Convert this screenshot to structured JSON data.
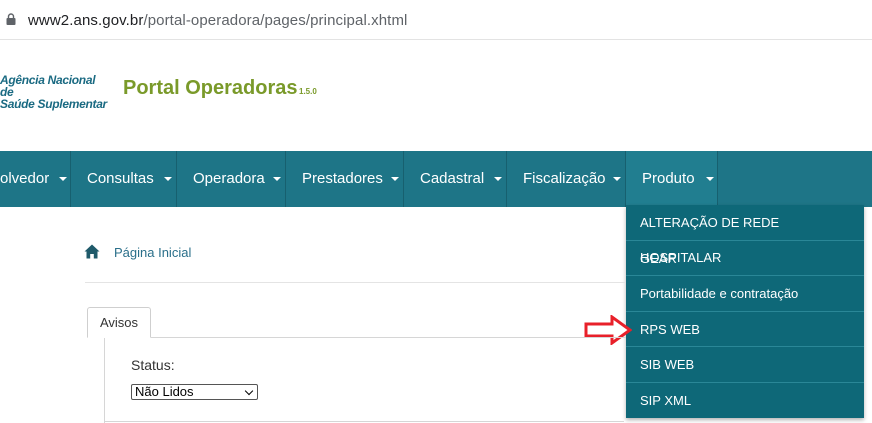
{
  "browser": {
    "url_host": "www2.ans.gov.br",
    "url_path": "/portal-operadora/pages/principal.xhtml"
  },
  "header": {
    "logo_line1": "Agência Nacional de",
    "logo_line2": "Saúde Suplementar",
    "title": "Portal Operadoras",
    "version": "1.5.0"
  },
  "nav": {
    "items": [
      {
        "label": "olvedor"
      },
      {
        "label": "Consultas"
      },
      {
        "label": "Operadora"
      },
      {
        "label": "Prestadores"
      },
      {
        "label": "Cadastral"
      },
      {
        "label": "Fiscalização"
      },
      {
        "label": "Produto"
      }
    ],
    "color": "#1e7587"
  },
  "dropdown": {
    "items": [
      {
        "label": "ALTERAÇÃO DE REDE HOSPITALAR"
      },
      {
        "label": "GEAR"
      },
      {
        "label": "Portabilidade e contratação"
      },
      {
        "label": "RPS WEB"
      },
      {
        "label": "SIB WEB"
      },
      {
        "label": "SIP XML"
      }
    ],
    "color": "#0e6878"
  },
  "annotation": {
    "arrow_color": "#e8202a",
    "icon": "red-arrow-icon"
  },
  "breadcrumb": {
    "icon": "home-icon",
    "label": "Página Inicial"
  },
  "tabs": {
    "active_label": "Avisos"
  },
  "filters": {
    "status_label": "Status:",
    "status_value": "Não Lidos"
  }
}
